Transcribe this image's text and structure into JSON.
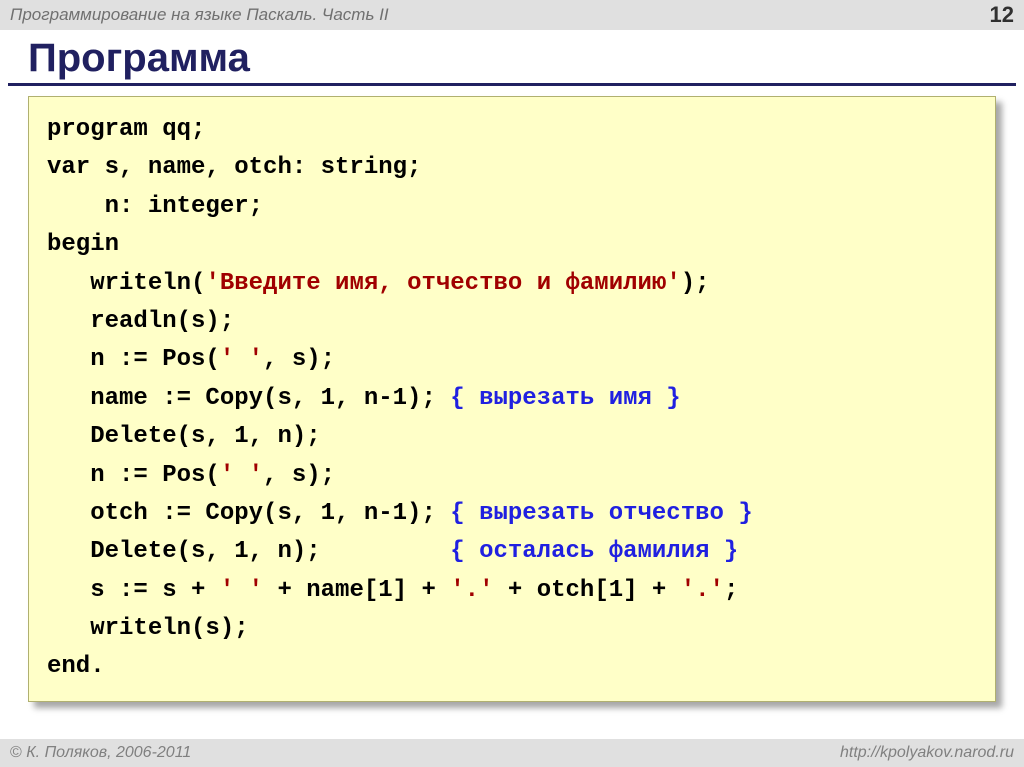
{
  "header": {
    "title": "Программирование на языке Паскаль. Часть II",
    "page_number": "12"
  },
  "heading": "Программа",
  "code": {
    "l01": "program qq;",
    "l02": "var s, name, otch: string;",
    "l03": "    n: integer;",
    "l04": "begin",
    "l05a": "   writeln(",
    "l05s": "'Введите имя, отчество и фамилию'",
    "l05b": ");",
    "l06": "   readln(s);",
    "l07a": "   n := Pos(",
    "l07s": "' '",
    "l07b": ", s);",
    "l08a": "   name := Copy(s, 1, n-1); ",
    "l08c": "{ вырезать имя }",
    "l09": "   Delete(s, 1, n);",
    "l10a": "   n := Pos(",
    "l10s": "' '",
    "l10b": ", s);",
    "l11a": "   otch := Copy(s, 1, n-1); ",
    "l11c": "{ вырезать отчество }",
    "l12a": "   Delete(s, 1, n);         ",
    "l12c": "{ осталась фамилия }",
    "l13a": "   s := s + ",
    "l13s1": "' '",
    "l13b": " + name[1] + ",
    "l13s2": "'.'",
    "l13c": " + otch[1] + ",
    "l13s3": "'.'",
    "l13d": ";",
    "l14": "   writeln(s);",
    "l15": "end."
  },
  "footer": {
    "copyright": " К. Поляков, 2006-2011",
    "url": "http://kpolyakov.narod.ru"
  }
}
